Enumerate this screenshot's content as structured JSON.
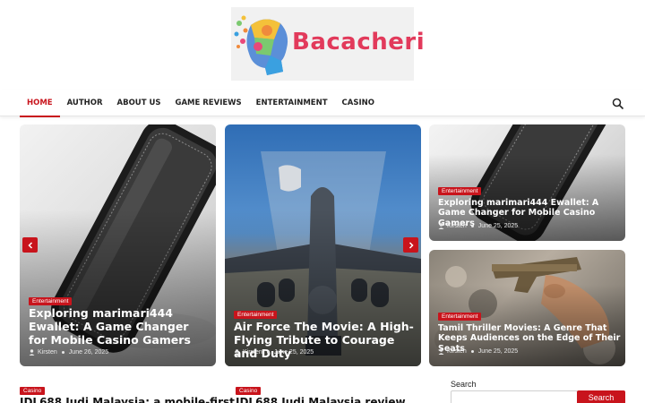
{
  "site": {
    "name": "Bacacheri"
  },
  "nav": {
    "items": [
      {
        "label": "HOME",
        "active": true
      },
      {
        "label": "AUTHOR"
      },
      {
        "label": "ABOUT US"
      },
      {
        "label": "GAME REVIEWS"
      },
      {
        "label": "ENTERTAINMENT"
      },
      {
        "label": "CASINO"
      }
    ],
    "search_icon": "search-icon"
  },
  "slider": {
    "slides": [
      {
        "category": "Entertainment",
        "title": "Exploring marimari444 Ewallet: A Game Changer for Mobile Casino Gamers",
        "author": "Kirsten",
        "date": "June 26, 2025",
        "image": "black-wallet-case"
      },
      {
        "category": "Entertainment",
        "title": "Air Force The Movie: A High-Flying Tribute to Courage and Duty",
        "author": "Kirsten",
        "date": "June 25, 2025",
        "image": "military-cargo-plane"
      }
    ],
    "prev_icon": "chevron-left-icon",
    "next_icon": "chevron-right-icon"
  },
  "side_cards": [
    {
      "category": "Entertainment",
      "title": "Exploring marimari444 Ewallet: A Game Changer for Mobile Casino Gamers",
      "author": "Kirsten",
      "date": "June 25, 2025",
      "image": "black-wallet-case"
    },
    {
      "category": "Entertainment",
      "title": "Tamil Thriller Movies: A Genre That Keeps Audiences on the Edge of Their Seats",
      "author": "Kirsten",
      "date": "June 25, 2025",
      "image": "hand-holding-pistol"
    }
  ],
  "posts": [
    {
      "category": "Casino",
      "title": "JDL688 Judi Malaysia: a mobile-first"
    },
    {
      "category": "Casino",
      "title": "JDL688 Judi Malaysia review"
    }
  ],
  "sidebar_search": {
    "label": "Search",
    "placeholder": "",
    "button": "Search"
  },
  "colors": {
    "accent": "#c8141c",
    "logo_text": "#e23a5b"
  }
}
